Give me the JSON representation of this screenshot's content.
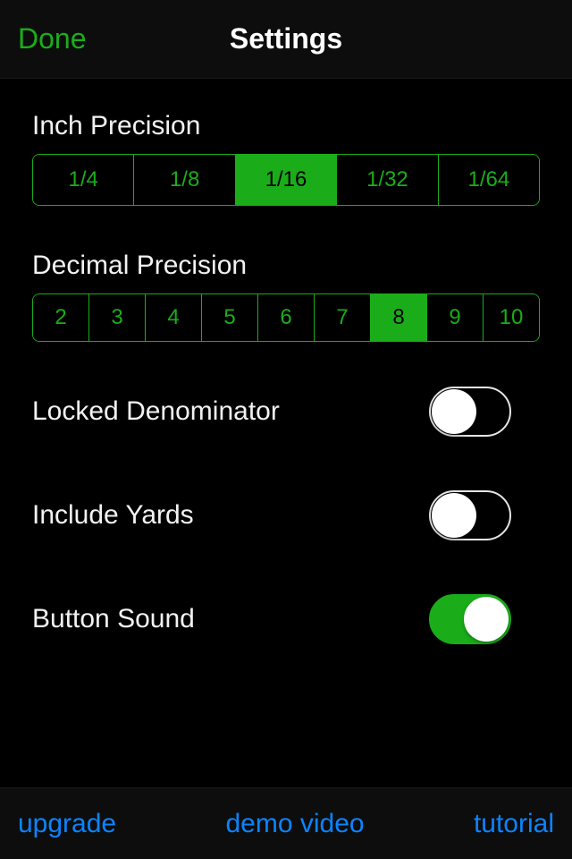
{
  "nav": {
    "done": "Done",
    "title": "Settings"
  },
  "inch": {
    "label": "Inch Precision",
    "opts": [
      "1/4",
      "1/8",
      "1/16",
      "1/32",
      "1/64"
    ],
    "selected": 2
  },
  "decimal": {
    "label": "Decimal Precision",
    "opts": [
      "2",
      "3",
      "4",
      "5",
      "6",
      "7",
      "8",
      "9",
      "10"
    ],
    "selected": 6
  },
  "toggles": {
    "locked": {
      "label": "Locked Denominator",
      "on": false
    },
    "yards": {
      "label": "Include Yards",
      "on": false
    },
    "sound": {
      "label": "Button Sound",
      "on": true
    }
  },
  "toolbar": {
    "upgrade": "upgrade",
    "demo": "demo video",
    "tutorial": "tutorial"
  }
}
